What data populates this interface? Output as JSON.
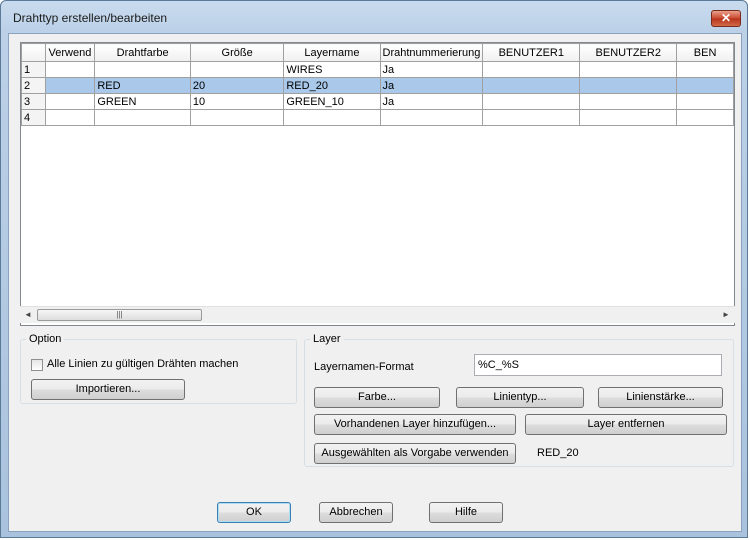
{
  "window": {
    "title": "Drahttyp erstellen/bearbeiten",
    "close_label": "✕"
  },
  "grid": {
    "columns": [
      "",
      "Verwend",
      "Drahtfarbe",
      "Größe",
      "Layername",
      "Drahtnummerierung",
      "BENUTZER1",
      "BENUTZER2",
      "BEN"
    ],
    "rows": [
      [
        "1",
        "",
        "",
        "",
        "WIRES",
        "Ja",
        "",
        "",
        ""
      ],
      [
        "2",
        "",
        "RED",
        "20",
        "RED_20",
        "Ja",
        "",
        "",
        ""
      ],
      [
        "3",
        "",
        "GREEN",
        "10",
        "GREEN_10",
        "Ja",
        "",
        "",
        ""
      ],
      [
        "4",
        "",
        "",
        "",
        "",
        "",
        "",
        "",
        ""
      ]
    ],
    "selected_row": 1,
    "scroll_thumb_glyph": "|||",
    "arrow_left": "◄",
    "arrow_right": "►"
  },
  "option": {
    "legend": "Option",
    "checkbox_label": "Alle Linien zu gültigen Drähten machen",
    "checkbox_checked": false,
    "import_button": "Importieren..."
  },
  "layer": {
    "legend": "Layer",
    "format_label": "Layernamen-Format",
    "format_value": "%C_%S",
    "color_button": "Farbe...",
    "linetype_button": "Linientyp...",
    "lineweight_button": "Linienstärke...",
    "add_existing_button": "Vorhandenen Layer hinzufügen...",
    "remove_button": "Layer entfernen",
    "use_selected_button": "Ausgewählten als Vorgabe verwenden",
    "current_default": "RED_20"
  },
  "footer": {
    "ok": "OK",
    "cancel": "Abbrechen",
    "help": "Hilfe"
  },
  "colors": {
    "selected_row": "#a9c8ea",
    "window_frame": "#bcd1e8",
    "close_button": "#c9472d"
  }
}
